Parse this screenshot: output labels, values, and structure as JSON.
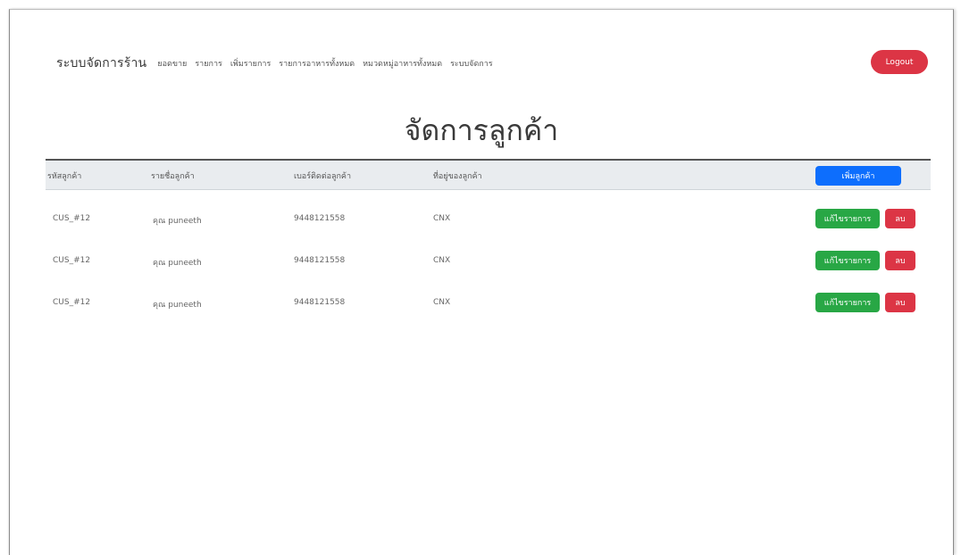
{
  "navbar": {
    "brand": "ระบบจัดการร้าน",
    "links": [
      "ยอดขาย",
      "รายการ",
      "เพิ่มรายการ",
      "รายการอาหารทั้งหมด",
      "หมวดหมู่อาหารทั้งหมด",
      "ระบบจัดการ"
    ],
    "logout_label": "Logout"
  },
  "page": {
    "title": "จัดการลูกค้า"
  },
  "table": {
    "headers": [
      "รหัสลูกค้า",
      "รายชื่อลูกค้า",
      "เบอร์ติดต่อลูกค้า",
      "ที่อยู่ของลูกค้า"
    ],
    "add_label": "เพิ่มลูกค้า",
    "rows": [
      {
        "id": "CUS_#12",
        "name": "คุณ puneeth",
        "phone": "9448121558",
        "address": "CNX",
        "edit_label": "แก้ไขรายการ",
        "delete_label": "ลบ"
      },
      {
        "id": "CUS_#12",
        "name": "คุณ puneeth",
        "phone": "9448121558",
        "address": "CNX",
        "edit_label": "แก้ไขรายการ",
        "delete_label": "ลบ"
      },
      {
        "id": "CUS_#12",
        "name": "คุณ puneeth",
        "phone": "9448121558",
        "address": "CNX",
        "edit_label": "แก้ไขรายการ",
        "delete_label": "ลบ"
      }
    ]
  },
  "colors": {
    "primary": "#0d6efd",
    "success": "#28a745",
    "danger": "#dc3545",
    "header_bg": "#e9ecef"
  }
}
